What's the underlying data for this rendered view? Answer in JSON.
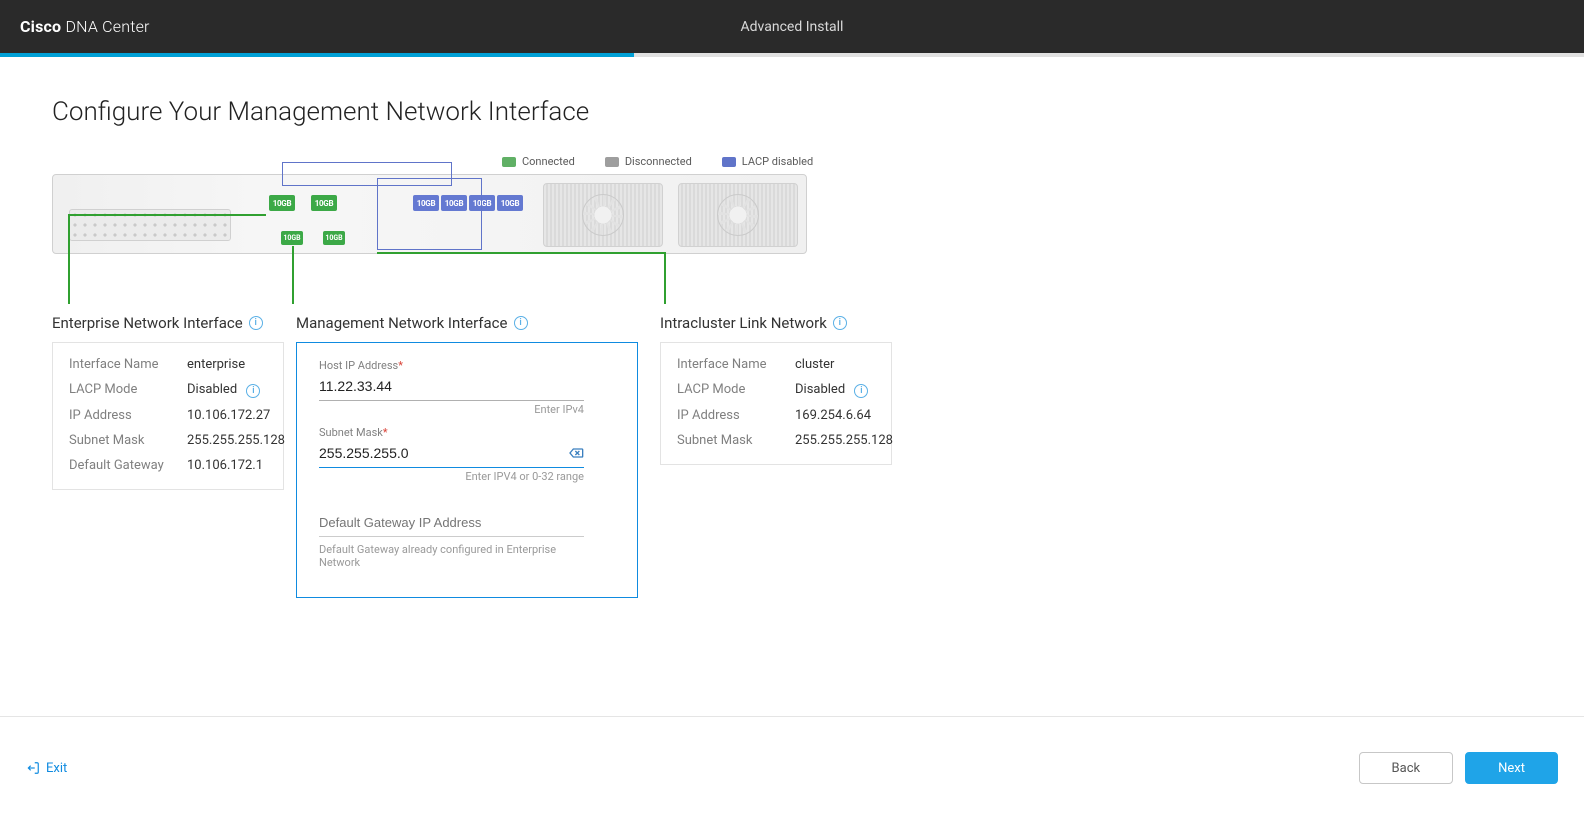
{
  "header": {
    "brand_bold": "Cisco",
    "brand_light": "DNA Center",
    "center_label": "Advanced Install"
  },
  "progress_percent": 40,
  "page_title": "Configure Your Management Network Interface",
  "legend": {
    "connected": "Connected",
    "disconnected": "Disconnected",
    "lacp_disabled": "LACP disabled"
  },
  "ports": {
    "top_green": [
      "10GB",
      "10GB"
    ],
    "top_blue": [
      "10GB",
      "10GB",
      "10GB",
      "10GB"
    ],
    "bottom_green": [
      "10GB",
      "10GB"
    ]
  },
  "sections": {
    "enterprise": {
      "title": "Enterprise Network Interface",
      "rows": {
        "Interface Name": "enterprise",
        "LACP Mode": "Disabled",
        "IP Address": "10.106.172.27",
        "Subnet Mask": "255.255.255.128",
        "Default Gateway": "10.106.172.1"
      }
    },
    "management": {
      "title": "Management Network Interface",
      "host_ip_label": "Host IP Address",
      "host_ip_value": "11.22.33.44",
      "host_ip_hint": "Enter IPv4",
      "subnet_label": "Subnet Mask",
      "subnet_value": "255.255.255.0",
      "subnet_hint": "Enter IPV4 or 0-32 range",
      "gateway_label": "Default Gateway IP Address",
      "gateway_value": "",
      "gateway_note": "Default Gateway already configured in Enterprise Network"
    },
    "intracluster": {
      "title": "Intracluster Link Network",
      "rows": {
        "Interface Name": "cluster",
        "LACP Mode": "Disabled",
        "IP Address": "169.254.6.64",
        "Subnet Mask": "255.255.255.128"
      }
    }
  },
  "footer": {
    "exit": "Exit",
    "back": "Back",
    "next": "Next"
  }
}
